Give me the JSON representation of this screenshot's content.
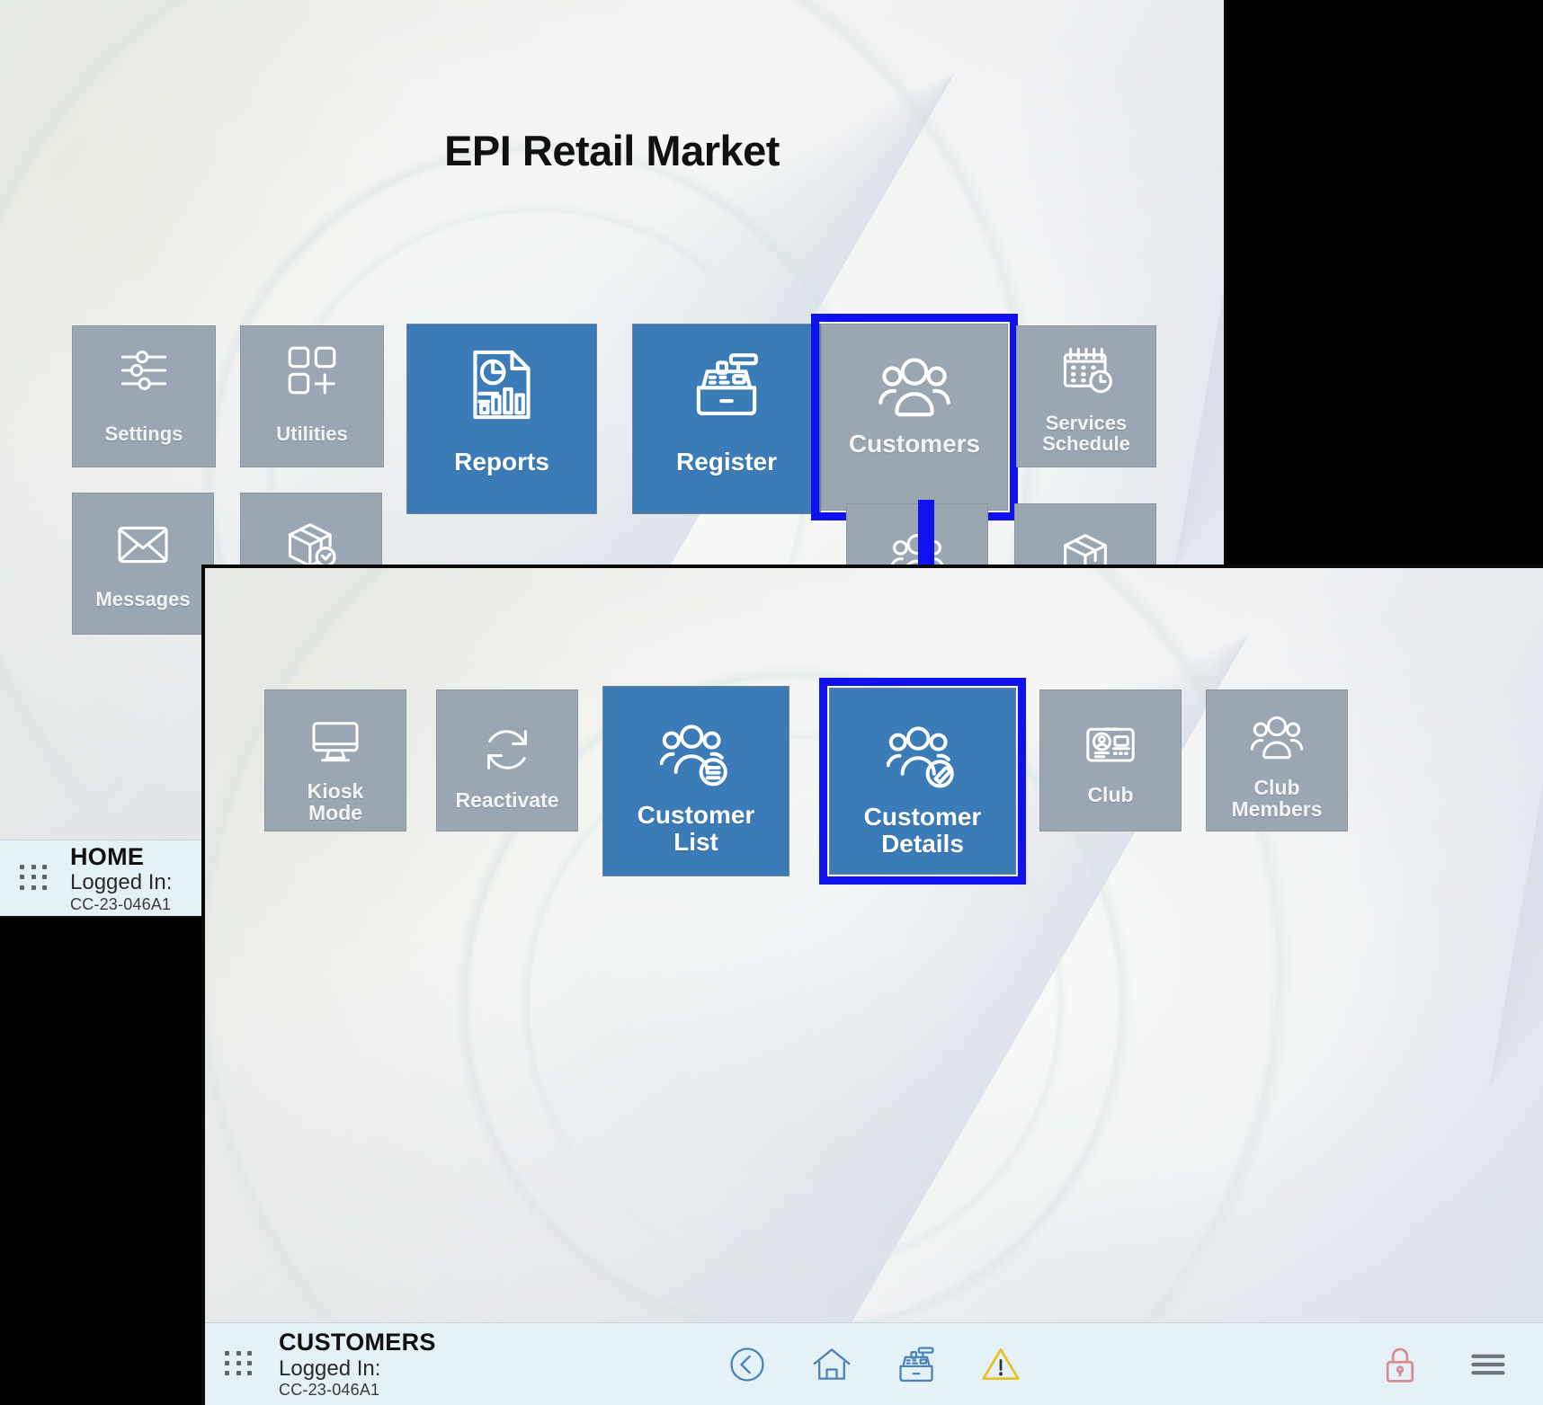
{
  "back_window": {
    "title": "EPI Retail Market",
    "tiles": [
      {
        "label": "Settings",
        "icon": "sliders-icon",
        "state": "gray",
        "size": "small",
        "highlight": false
      },
      {
        "label": "Utilities",
        "icon": "app-grid-plus-icon",
        "state": "gray",
        "size": "small",
        "highlight": false
      },
      {
        "label": "Reports",
        "icon": "report-chart-icon",
        "state": "blue",
        "size": "large",
        "highlight": false
      },
      {
        "label": "Register",
        "icon": "cash-register-icon",
        "state": "blue",
        "size": "large",
        "highlight": false
      },
      {
        "label": "Customers",
        "icon": "customers-group-icon",
        "state": "gray",
        "size": "large",
        "highlight": true
      },
      {
        "label": "Services\nSchedule",
        "icon": "calendar-clock-icon",
        "state": "gray",
        "size": "small",
        "highlight": false
      },
      {
        "label": "Messages",
        "icon": "envelope-icon",
        "state": "gray",
        "size": "small",
        "highlight": false
      },
      {
        "label": "",
        "icon": "package-clock-icon",
        "state": "gray",
        "size": "small",
        "highlight": false
      },
      {
        "label": "",
        "icon": "customers-group-icon",
        "state": "gray",
        "size": "small",
        "highlight": false
      },
      {
        "label": "",
        "icon": "package-box-icon",
        "state": "gray",
        "size": "small",
        "highlight": false
      }
    ],
    "statusbar": {
      "title": "HOME",
      "logged_in_label": "Logged In:",
      "terminal_code": "CC-23-046A1",
      "grip_icon": "drag-grip-icon"
    }
  },
  "front_window": {
    "tiles": [
      {
        "label": "Kiosk\nMode",
        "icon": "monitor-icon",
        "state": "gray",
        "highlight": false
      },
      {
        "label": "Reactivate",
        "icon": "refresh-circular-icon",
        "state": "gray",
        "highlight": false
      },
      {
        "label": "Customer\nList",
        "icon": "customers-list-icon",
        "state": "blue",
        "highlight": false
      },
      {
        "label": "Customer\nDetails",
        "icon": "customers-edit-icon",
        "state": "blue",
        "highlight": true
      },
      {
        "label": "Club",
        "icon": "membership-card-icon",
        "state": "gray",
        "highlight": false
      },
      {
        "label": "Club\nMembers",
        "icon": "customers-group-icon",
        "state": "gray",
        "highlight": false
      }
    ],
    "statusbar": {
      "title": "CUSTOMERS",
      "logged_in_label": "Logged In:",
      "terminal_code": "CC-23-046A1",
      "grip_icon": "drag-grip-icon",
      "center_icons": [
        {
          "name": "back-icon",
          "glyph": "back"
        },
        {
          "name": "home-icon",
          "glyph": "home"
        },
        {
          "name": "register-icon",
          "glyph": "register"
        },
        {
          "name": "warning-alert-icon",
          "glyph": "warning"
        }
      ],
      "right_icons": [
        {
          "name": "lock-icon",
          "glyph": "lock"
        },
        {
          "name": "hamburger-menu-icon",
          "glyph": "menu"
        }
      ]
    }
  },
  "annotation": {
    "arrow_icon": "flow-arrow-down-icon",
    "highlight_color": "#0f11ef",
    "accent_blue": "#3b7cb8",
    "tile_gray": "#9aa7b2",
    "statusbar_bg": "#e4f1f7",
    "lock_color": "#d98b90",
    "warning_color": "#e8bf26"
  }
}
